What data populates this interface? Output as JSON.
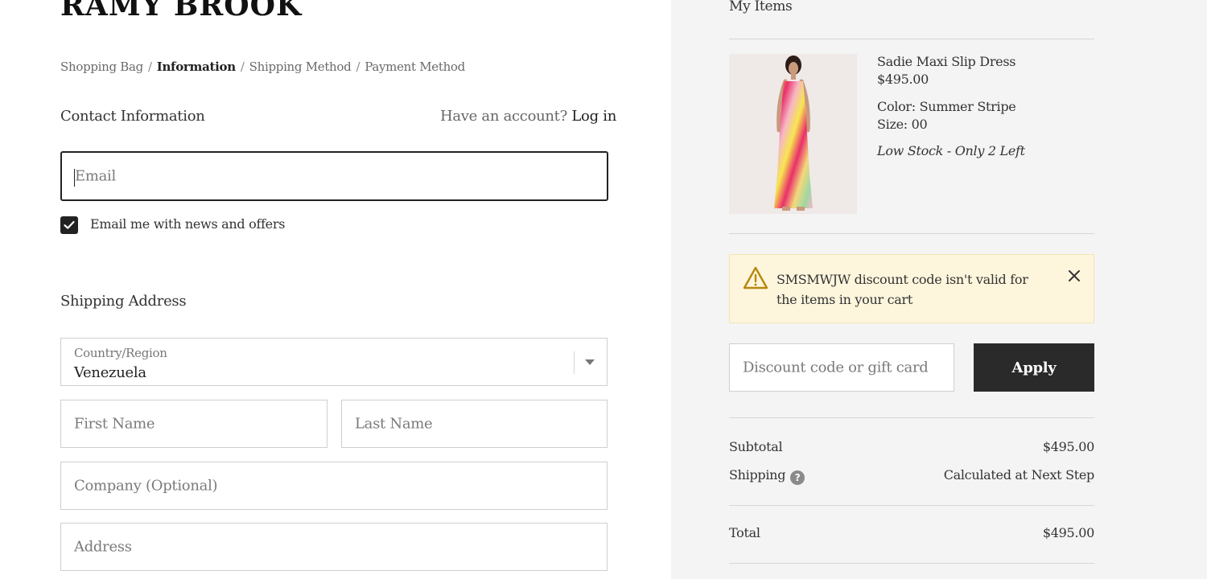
{
  "brand": {
    "logo_text": "RAMY BROOK"
  },
  "breadcrumb": {
    "items": [
      "Shopping Bag",
      "Information",
      "Shipping Method",
      "Payment Method"
    ],
    "separator": "/"
  },
  "contact": {
    "heading": "Contact Information",
    "account_prompt": "Have an account?",
    "login_label": "Log in",
    "email_placeholder": "Email",
    "newsletter_label": "Email me with news and offers",
    "newsletter_checked": true
  },
  "shipping": {
    "heading": "Shipping Address",
    "country_label": "Country/Region",
    "country_value": "Venezuela",
    "first_name_placeholder": "First Name",
    "last_name_placeholder": "Last Name",
    "company_placeholder": "Company (Optional)",
    "address_placeholder": "Address"
  },
  "cart": {
    "heading": "My Items",
    "item": {
      "name": "Sadie Maxi Slip Dress",
      "price": "$495.00",
      "color": "Color: Summer Stripe",
      "size": "Size: 00",
      "stock_note": "Low Stock - Only 2 Left"
    },
    "alert": {
      "message": "SMSMWJW discount code isn't valid for the items in your cart"
    },
    "discount_placeholder": "Discount code or gift card",
    "apply_label": "Apply",
    "subtotal_label": "Subtotal",
    "subtotal_value": "$495.00",
    "shipping_label": "Shipping",
    "shipping_value": "Calculated at Next Step",
    "total_label": "Total",
    "total_value": "$495.00"
  },
  "colors": {
    "primary_button": "#2a2a2a",
    "alert_background": "#fdf6dd",
    "alert_icon": "#b8860b",
    "sidebar_background": "#f4f4f4"
  },
  "icons": [
    "warning-icon",
    "close-icon",
    "help-icon",
    "chevron-down-icon",
    "checkmark-icon"
  ]
}
